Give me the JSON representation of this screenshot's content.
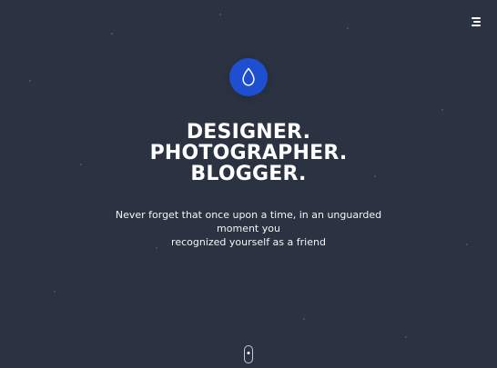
{
  "header": {
    "menu_icon": "hamburger-icon"
  },
  "hero": {
    "logo_icon": "water-drop-icon",
    "headline_line_1": "DESIGNER. PHOTOGRAPHER.",
    "headline_line_2": "BLOGGER.",
    "tagline_line_1": "Never forget that once upon a time, in an unguarded moment you",
    "tagline_line_2": "recognized yourself as a friend"
  },
  "scroll": {
    "icon": "mouse-scroll-icon"
  },
  "theme": {
    "background": "#2b3342",
    "accent": "#1d4fd0",
    "text": "#ffffff"
  }
}
